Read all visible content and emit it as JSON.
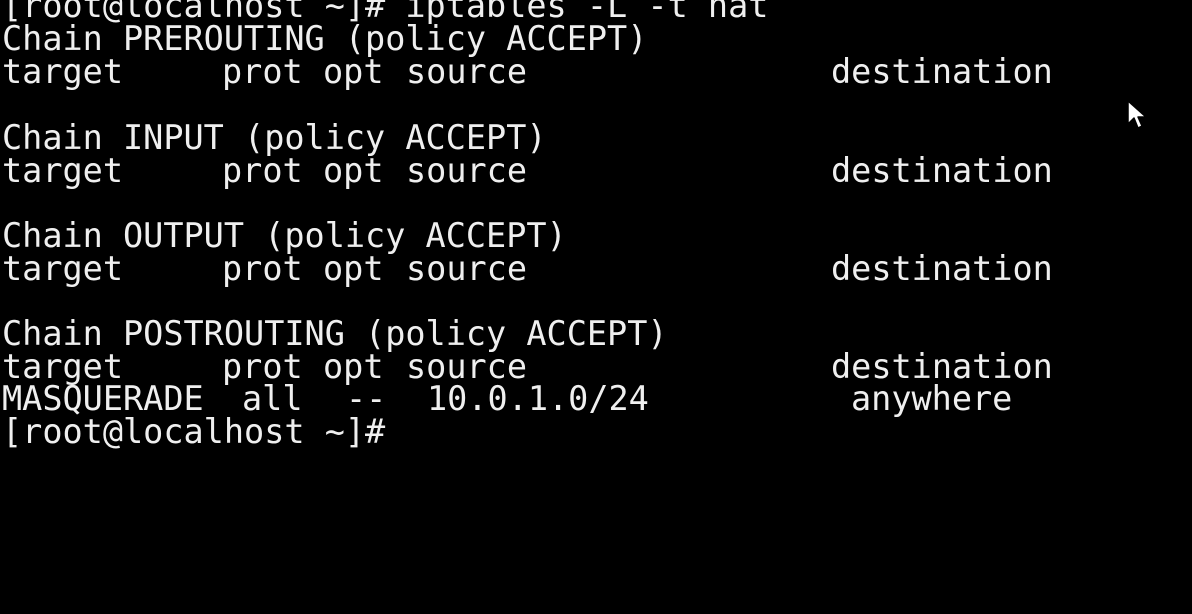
{
  "terminal": {
    "prompt_line": "[root@localhost ~]# iptables -L -t nat",
    "chains": [
      {
        "header": "Chain PREROUTING (policy ACCEPT)"
      },
      {
        "header": "Chain INPUT (policy ACCEPT)"
      },
      {
        "header": "Chain OUTPUT (policy ACCEPT)"
      },
      {
        "header": "Chain POSTROUTING (policy ACCEPT)"
      }
    ],
    "columns": {
      "target": "target",
      "prot": "prot",
      "opt": "opt",
      "source": "source",
      "destination": "destination"
    },
    "rule": {
      "target": "MASQUERADE",
      "prot": "all",
      "opt": "--",
      "source": "10.0.1.0/24",
      "destination": "anywhere"
    },
    "next_prompt": "[root@localhost ~]#"
  },
  "cursor_icon": "mouse-pointer-icon"
}
